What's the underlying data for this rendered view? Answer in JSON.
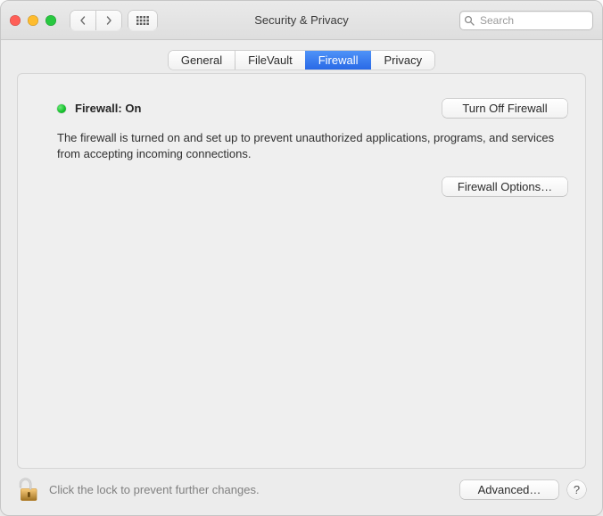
{
  "window": {
    "title": "Security & Privacy"
  },
  "search": {
    "placeholder": "Search",
    "value": ""
  },
  "tabs": [
    {
      "label": "General",
      "selected": false
    },
    {
      "label": "FileVault",
      "selected": false
    },
    {
      "label": "Firewall",
      "selected": true
    },
    {
      "label": "Privacy",
      "selected": false
    }
  ],
  "firewall": {
    "status_label": "Firewall: On",
    "status_color": "#18c22f",
    "turn_off_label": "Turn Off Firewall",
    "description": "The firewall is turned on and set up to prevent unauthorized applications, programs, and services from accepting incoming connections.",
    "options_label": "Firewall Options…"
  },
  "footer": {
    "lock_text": "Click the lock to prevent further changes.",
    "advanced_label": "Advanced…",
    "help_label": "?"
  }
}
